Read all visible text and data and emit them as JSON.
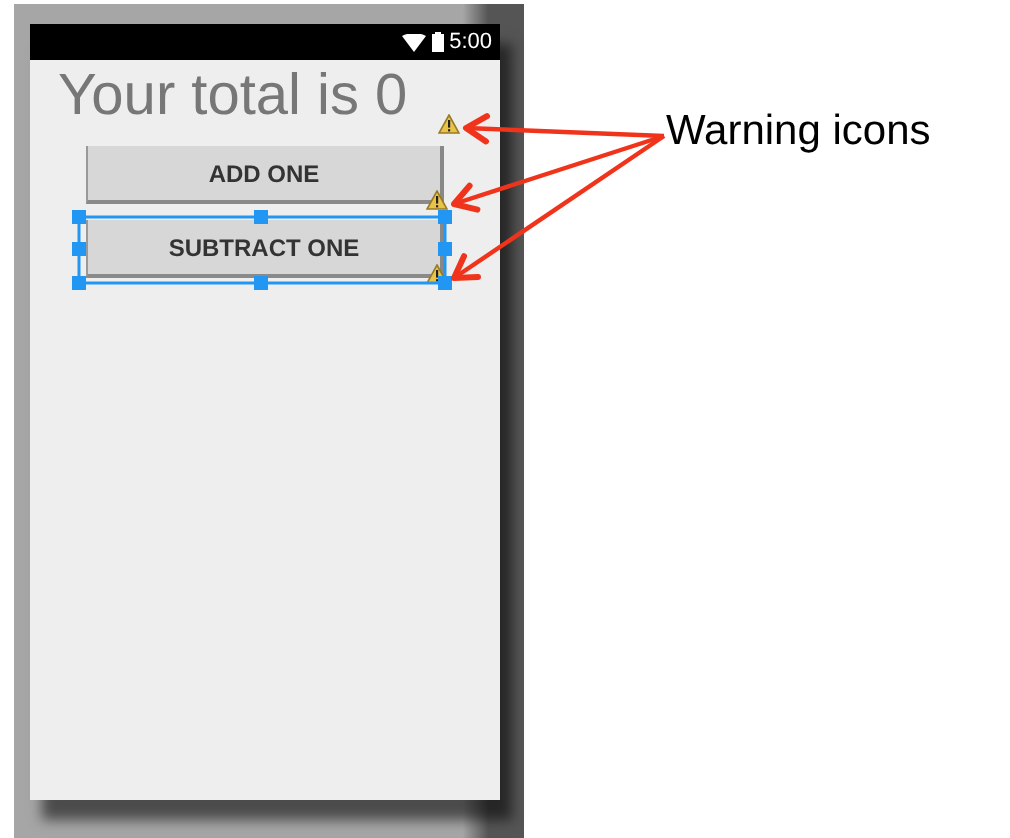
{
  "status_bar": {
    "time": "5:00"
  },
  "title": {
    "text": "Your total is 0",
    "warning": true
  },
  "buttons": [
    {
      "label": "ADD ONE",
      "warning": true,
      "selected": false
    },
    {
      "label": "SUBTRACT ONE",
      "warning": true,
      "selected": true
    }
  ],
  "annotation": {
    "label": "Warning icons"
  }
}
